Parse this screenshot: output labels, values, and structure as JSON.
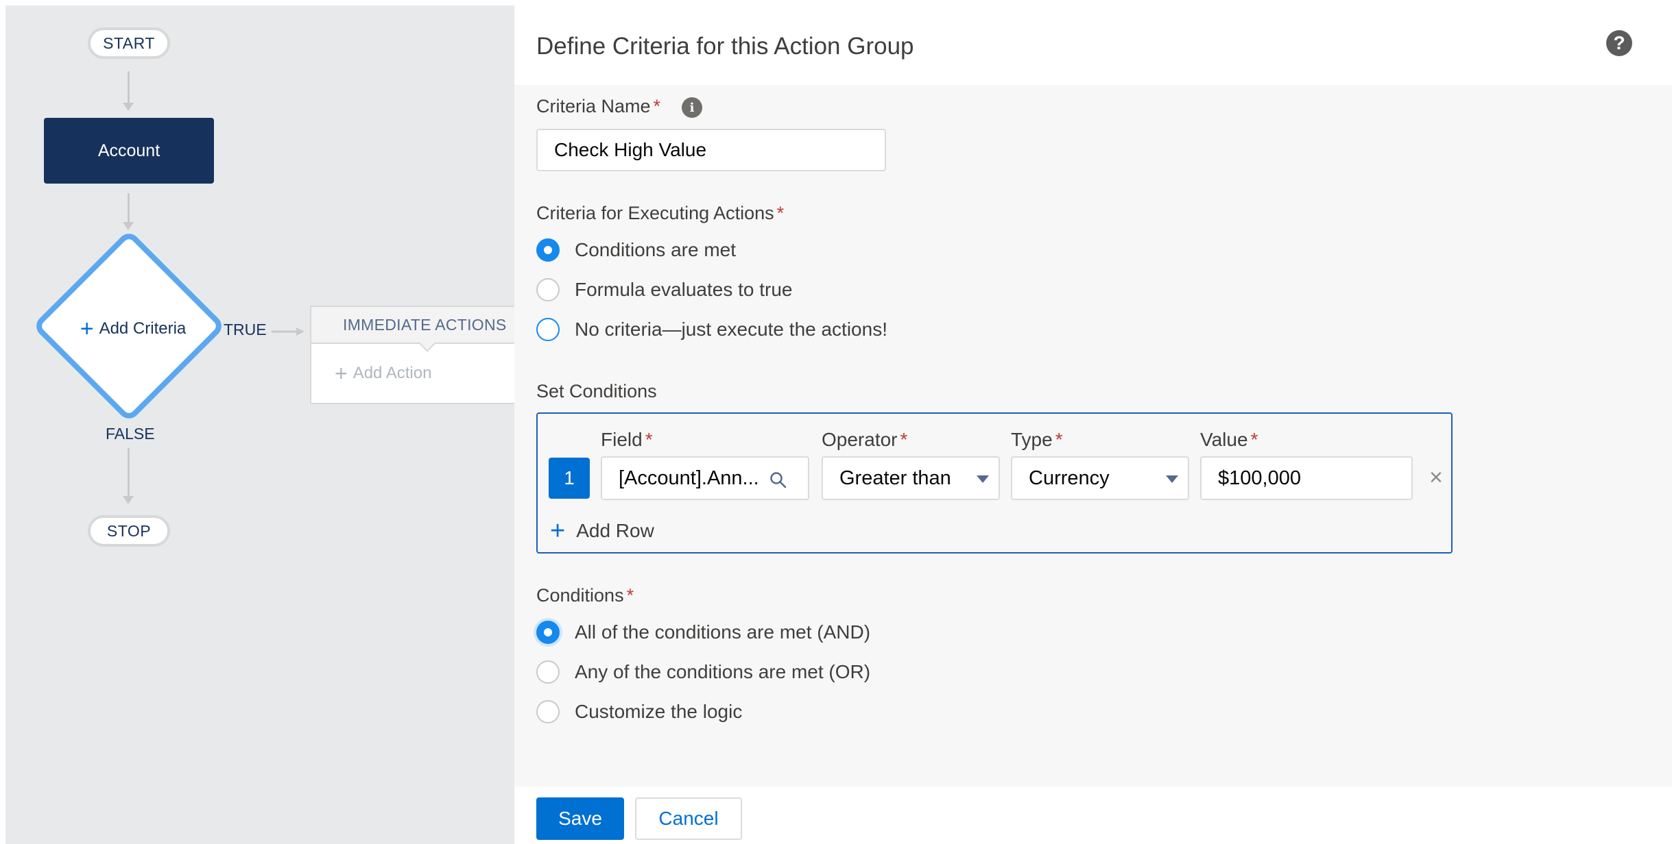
{
  "flow": {
    "start": "START",
    "object": "Account",
    "add_criteria": "Add Criteria",
    "true_label": "TRUE",
    "false_label": "FALSE",
    "stop": "STOP",
    "immediate_actions": "IMMEDIATE ACTIONS",
    "add_action": "Add Action"
  },
  "panel": {
    "title": "Define Criteria for this Action Group",
    "criteria_name_label": "Criteria Name",
    "criteria_name_value": "Check High Value",
    "executing_label": "Criteria for Executing Actions",
    "executing_options": [
      {
        "label": "Conditions are met",
        "checked": true
      },
      {
        "label": "Formula evaluates to true",
        "checked": false
      },
      {
        "label": "No criteria—just execute the actions!",
        "checked": false
      }
    ],
    "set_conditions_label": "Set Conditions",
    "columns": {
      "field": "Field",
      "operator": "Operator",
      "type": "Type",
      "value": "Value"
    },
    "row": {
      "number": "1",
      "field": "[Account].Ann...",
      "operator": "Greater than",
      "type": "Currency",
      "value": "$100,000"
    },
    "add_row": "Add Row",
    "conditions_label": "Conditions",
    "logic_options": [
      {
        "label": "All of the conditions are met (AND)",
        "checked": true
      },
      {
        "label": "Any of the conditions are met (OR)",
        "checked": false
      },
      {
        "label": "Customize the logic",
        "checked": false
      }
    ],
    "save": "Save",
    "cancel": "Cancel",
    "required_mark": "*"
  },
  "colors": {
    "brand": "#0070d2",
    "node_dark": "#16325c",
    "checked_radio": "#1589ee",
    "required": "#c23934"
  }
}
